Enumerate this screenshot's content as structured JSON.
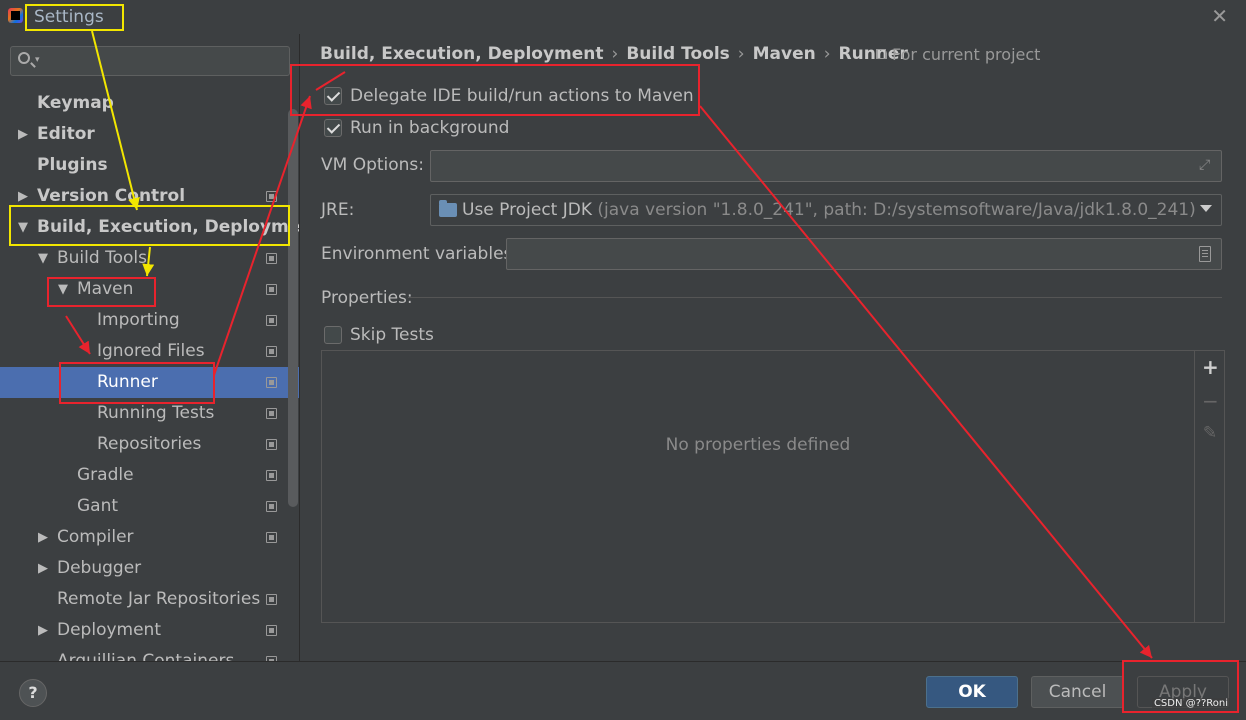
{
  "window": {
    "title": "Settings",
    "close_glyph": "✕"
  },
  "sidebar": {
    "search_value": "",
    "items": [
      {
        "label": "Keymap"
      },
      {
        "label": "Editor",
        "arrow": "▶"
      },
      {
        "label": "Plugins"
      },
      {
        "label": "Version Control",
        "arrow": "▶"
      },
      {
        "label": "Build, Execution, Deployment",
        "arrow": "▼"
      },
      {
        "label": "Build Tools",
        "arrow": "▼"
      },
      {
        "label": "Maven",
        "arrow": "▼"
      },
      {
        "label": "Importing"
      },
      {
        "label": "Ignored Files"
      },
      {
        "label": "Runner"
      },
      {
        "label": "Running Tests"
      },
      {
        "label": "Repositories"
      },
      {
        "label": "Gradle"
      },
      {
        "label": "Gant"
      },
      {
        "label": "Compiler",
        "arrow": "▶"
      },
      {
        "label": "Debugger",
        "arrow": "▶"
      },
      {
        "label": "Remote Jar Repositories"
      },
      {
        "label": "Deployment",
        "arrow": "▶"
      },
      {
        "label": "Arquillian Containers"
      }
    ]
  },
  "breadcrumb": {
    "parts": [
      "Build, Execution, Deployment",
      "Build Tools",
      "Maven",
      "Runner"
    ],
    "separator": "›",
    "scope": "For current project"
  },
  "form": {
    "delegate_label": "Delegate IDE build/run actions to Maven",
    "delegate_checked": true,
    "background_label": "Run in background",
    "background_checked": true,
    "vm_options_label": "VM Options:",
    "vm_options_value": "",
    "jre_label": "JRE:",
    "jre_value": "Use Project JDK",
    "jre_detail": "(java version \"1.8.0_241\", path: D:/systemsoftware/Java/jdk1.8.0_241)",
    "env_label": "Environment variables:",
    "env_value": "",
    "properties_label": "Properties:",
    "skip_tests_label": "Skip Tests",
    "skip_tests_checked": false,
    "no_properties": "No properties defined",
    "toolbar": {
      "add": "+",
      "remove": "−",
      "edit": "✎"
    }
  },
  "footer": {
    "help": "?",
    "ok": "OK",
    "cancel": "Cancel",
    "apply": "Apply",
    "watermark": "CSDN @??Roni"
  },
  "annotation_colors": {
    "yellow": "#f2e600",
    "red": "#e8232d"
  }
}
